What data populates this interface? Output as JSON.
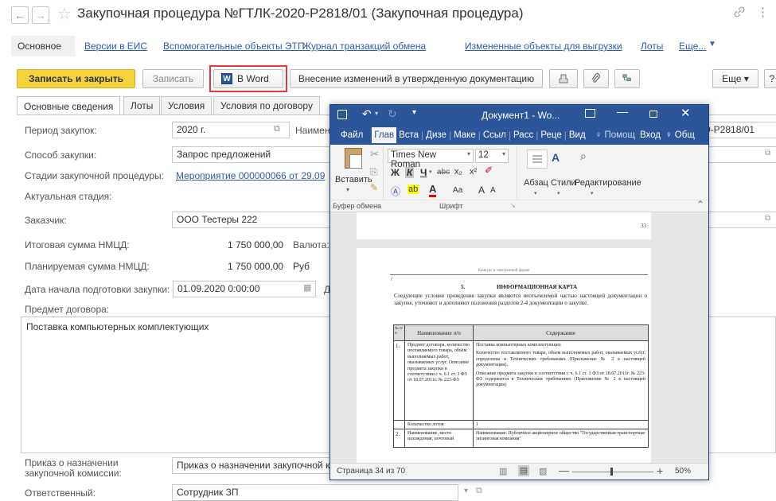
{
  "window": {
    "title": "Закупочная процедура №ГТЛК-2020-Р2818/01 (Закупочная процедура)",
    "star": "☆",
    "link_icon": "🔗",
    "more_icon": "⋮"
  },
  "nav_links": [
    "Основное",
    "Версии в ЕИС",
    "Вспомогательные объекты ЭТП",
    "Журнал транзакций обмена",
    "Измененные объекты для выгрузки",
    "Лоты",
    "Еще..."
  ],
  "toolbar": {
    "save_close": "Записать и закрыть",
    "save": "Записать",
    "word": "В Word",
    "word_icon_letter": "W",
    "changes": "Внесение изменений в утвержденную документацию",
    "more": "Еще",
    "more2": "?"
  },
  "tabs": [
    "Основные сведения",
    "Лоты",
    "Условия",
    "Условия по договору"
  ],
  "form": {
    "period_label": "Период закупок:",
    "period_value": "2020 г.",
    "name_label": "Наимен",
    "method_label": "Способ закупки:",
    "method_value": "Запрос предложений",
    "stages_label": "Стадии закупочной процедуры:",
    "stages_value": "Мероприятие 000000066 от 29.09",
    "actual_label": "Актуальная стадия:",
    "customer_label": "Заказчик:",
    "customer_value": "ООО Тестеры 222",
    "nmcd_label": "Итоговая сумма НМЦД:",
    "nmcd_value": "1 750 000,00",
    "currency_label": "Валюта:",
    "plan_label": "Планируемая сумма НМЦД:",
    "plan_value": "1 750 000,00",
    "plan_currency": "Руб",
    "start_label": "Дата начала подготовки закупки:",
    "start_value": "01.09.2020 0:00:00",
    "start_extra": "Д",
    "subject_label": "Предмет договора:",
    "subject_value": "Поставка компьютерных комплектующих",
    "order_label": "Приказ о назначении закупочной комиссии:",
    "order_value": "Приказ о назначении закупочной к",
    "resp_label": "Ответственный:",
    "resp_value": "Сотрудник ЗП",
    "right_name_value": "0-Р2818/01"
  },
  "word": {
    "title": "Документ1 - Wo...",
    "ribbon_tabs": [
      "Файл",
      "Глав",
      "Вста",
      "Дизе",
      "Маке",
      "Ссыл",
      "Расс",
      "Реце",
      "Вид"
    ],
    "help": "Помощ",
    "login": "Вход",
    "share": "Общ",
    "paste": "Вставить",
    "font_name": "Times New Roman",
    "font_size": "12",
    "bold": "Ж",
    "italic": "К",
    "underline": "Ч",
    "strike": "abc",
    "sub": "x₂",
    "sup": "x²",
    "aa": "Аа",
    "grow": "A",
    "shrink": "A",
    "paragraph": "Абзац",
    "styles": "Стили",
    "editing": "Редактирование",
    "clipboard_group": "Буфер обмена",
    "font_group": "Шрифт",
    "page_num": "33",
    "doc_header": "Конкурс в электронной форме",
    "section_num": "5.",
    "section_title": "ИНФОРМАЦИОННАЯ КАРТА",
    "intro": "Следующие условия проведения закупки являются неотъемлемой частью настоящей документации о закупке, уточняют и дополняют положения разделов 2-4 документации о закупке.",
    "col_num": "№ п/п",
    "col_name": "Наименование п/п",
    "col_content": "Содержание",
    "row1_num": "1.",
    "row1_name": "Предмет договора, количество поставляемого товара, объём выполняемых работ, оказываемых услуг. Описание предмета закупки в соответствии с ч. 6.1 ст. 3 ФЗ от 18.07.2011г. № 223-ФЗ",
    "row1_c1": "Поставка компьютерных комплектующих",
    "row1_c2": "Количество поставляемого товара, объем выполняемых работ, оказываемых услуг, определены в Технических требованиях (Приложение № 2 к настоящей документации).",
    "row1_c3": "Описание предмета закупки в соответствии с ч. 6.1 ст. 3 ФЗ от 18.07.2011г. № 223-ФЗ содержится в Технических требованиях (Приложение № 2 к настоящей документации)",
    "row_lots_name": "Количество лотов",
    "row_lots_val": "1",
    "row2_num": "2.",
    "row2_name": "Наименование, место нахождения, почтовый",
    "row2_content": "Наименование: Публичное акционерное общество \"Государственная транспортная лизинговая компания\"",
    "status_page": "Страница 34 из 70",
    "zoom": "50%"
  },
  "colors": {
    "accent_yellow": "#f5d33d",
    "word_blue": "#2b579a",
    "link_blue": "#2f5dab",
    "highlight_red": "#e53935"
  }
}
